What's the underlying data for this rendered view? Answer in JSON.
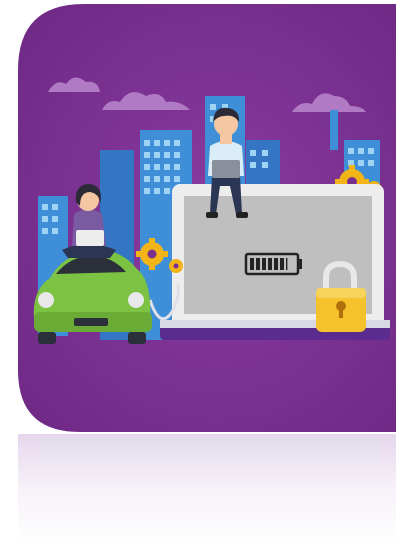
{
  "colors": {
    "background": "#ffffff",
    "card": "#7a2f8f",
    "cloud": "#b07ac4",
    "building": "#3e8fd8",
    "building_window": "#9fd3f6",
    "car": "#7cc243",
    "laptop_screen": "#ededed",
    "laptop_display": "#bfbfbf",
    "laptop_base": "#5b2c8f",
    "lock": "#f4c22b",
    "gear": "#f2b417",
    "person_shirt": "#d9ecf7",
    "person_pants": "#2a3654",
    "skin": "#f4c6a1",
    "hair": "#2b2b38"
  },
  "icons": [
    "battery-icon",
    "padlock-icon",
    "gear-icon",
    "cloud-icon",
    "car-icon",
    "laptop-icon"
  ],
  "battery": {
    "charge_level": 0.85
  }
}
